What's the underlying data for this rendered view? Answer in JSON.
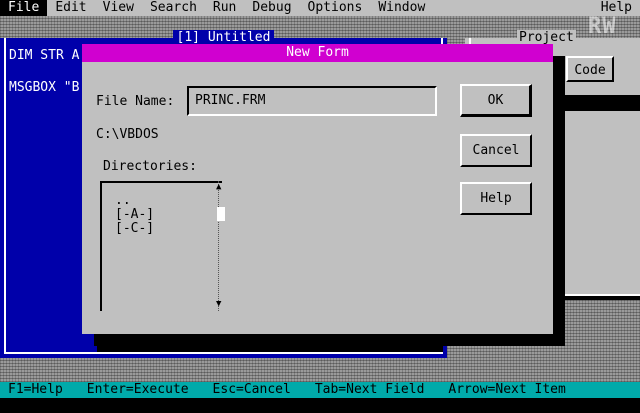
{
  "menubar": {
    "items": [
      "File",
      "Edit",
      "View",
      "Search",
      "Run",
      "Debug",
      "Options",
      "Window"
    ],
    "help": "Help"
  },
  "watermark": "RW",
  "code_window": {
    "title": "[1] Untitled",
    "lines": [
      "DIM STR A",
      "MSGBOX \"B"
    ]
  },
  "project_window": {
    "title": "Project",
    "code_button": "Code"
  },
  "dialog": {
    "title": "New Form",
    "file_name_label": "File Name:",
    "file_name_value": "PRINC.FRM",
    "current_dir": "C:\\VBDOS",
    "directories_label": "Directories:",
    "directories": [
      "..",
      "[-A-]",
      "[-C-]"
    ],
    "ok_label": "OK",
    "cancel_label": "Cancel",
    "help_label": "Help"
  },
  "statusbar": {
    "items": [
      "F1=Help",
      "Enter=Execute",
      "Esc=Cancel",
      "Tab=Next Field",
      "Arrow=Next Item"
    ]
  }
}
